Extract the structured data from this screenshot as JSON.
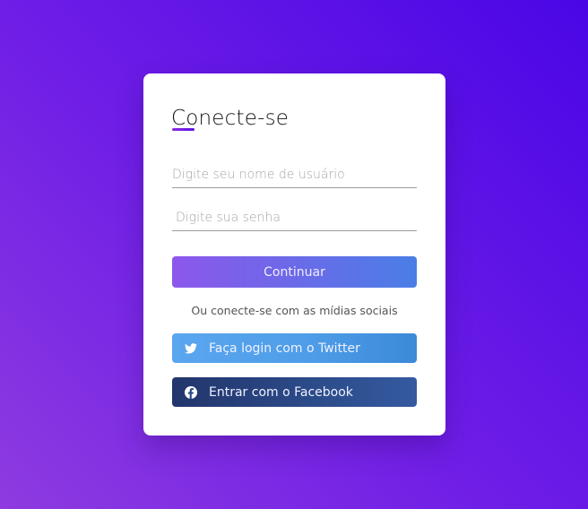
{
  "login": {
    "title": "Conecte-se",
    "username_placeholder": "Digite seu nome de usuário",
    "password_placeholder": "Digite sua senha",
    "continue_label": "Continuar",
    "social_text": "Ou conecte-se com as mídias sociais",
    "twitter_label": "Faça login com o Twitter",
    "facebook_label": "Entrar com o Facebook"
  },
  "icons": {
    "twitter": "twitter-icon",
    "facebook": "facebook-icon"
  },
  "colors": {
    "background_start": "#8e3be0",
    "background_end": "#4a06e6",
    "accent": "#6f1ee6",
    "continue_start": "#8c57ec",
    "continue_end": "#4a7ee6",
    "twitter": "#4f9de8",
    "facebook": "#2b4a88"
  }
}
